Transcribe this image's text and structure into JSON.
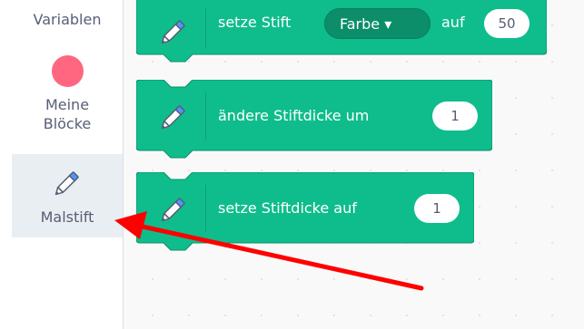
{
  "categories": {
    "variables_label": "Variablen",
    "my_blocks_label": "Meine\nBlöcke",
    "pen_label": "Malstift"
  },
  "blocks": [
    {
      "text": "setze Stift",
      "dropdown": "Farbe ▾",
      "text2": "auf",
      "value": "50"
    },
    {
      "text": "ändere Stiftdicke um",
      "value": "1"
    },
    {
      "text": "setze Stiftdicke auf",
      "value": "1"
    }
  ],
  "colors": {
    "pen_block": "#0fbd8c",
    "pen_block_border": "#0b8e69",
    "my_blocks_dot": "#ff6680",
    "arrow": "#ff0000",
    "selected_category_bg": "#e9eef2"
  },
  "icons": {
    "pen_category": "pen-icon",
    "block_icon": "pen-icon"
  }
}
